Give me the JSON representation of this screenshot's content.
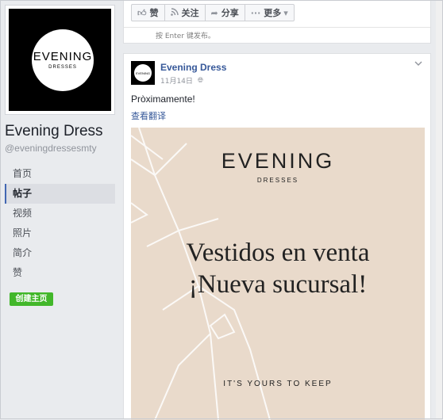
{
  "sidebar": {
    "cover_logo": {
      "word": "EVENING",
      "sub": "DRESSES"
    },
    "page_name": "Evening Dress",
    "page_handle": "@eveningdressesmty",
    "nav": [
      {
        "label": "首页",
        "active": false
      },
      {
        "label": "帖子",
        "active": true
      },
      {
        "label": "视频",
        "active": false
      },
      {
        "label": "照片",
        "active": false
      },
      {
        "label": "简介",
        "active": false
      },
      {
        "label": "赞",
        "active": false
      }
    ],
    "create_button": "创建主页"
  },
  "composer": {
    "actions": [
      {
        "icon": "thumbs-up-icon",
        "label": "赞"
      },
      {
        "icon": "rss-icon",
        "label": "关注"
      },
      {
        "icon": "share-arrow-icon",
        "label": "分享"
      },
      {
        "icon": "more-dots-icon",
        "label": "更多"
      }
    ],
    "hint": "按 Enter 键发布。"
  },
  "post": {
    "author": "Evening Dress",
    "avatar_word": "EVENING",
    "date": "11月14日",
    "text": "Pròximamente!",
    "translate_link": "查看翻译",
    "poster": {
      "brand": "EVENING",
      "brand_sub": "DRESSES",
      "line1": "Vestidos en venta",
      "line2": "¡Nueva sucursal!",
      "tagline": "IT'S YOURS TO KEEP"
    }
  },
  "colors": {
    "link": "#365899",
    "create_green": "#42b72a",
    "active_bar": "#4267b2",
    "poster_bg": "#e9dacb"
  }
}
